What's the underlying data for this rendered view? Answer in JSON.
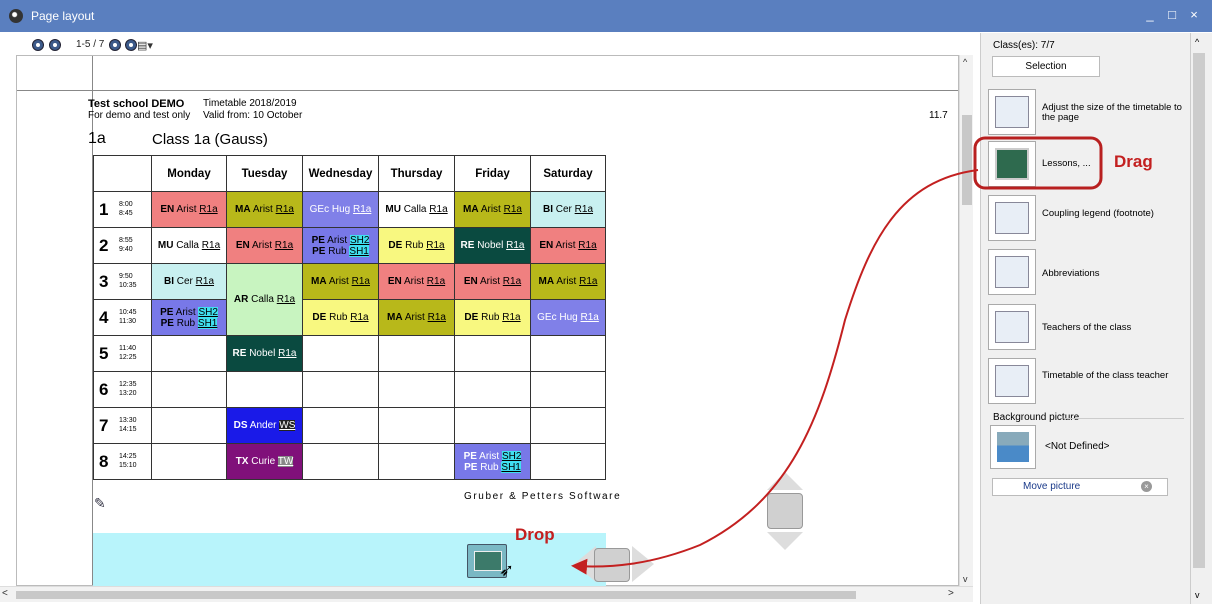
{
  "window": {
    "title": "Page layout",
    "min": "_",
    "max": "□",
    "close": "×"
  },
  "toolbar": {
    "page_indicator": "1-5 / 7",
    "layout_icon": "▤▾"
  },
  "header": {
    "school": "Test school DEMO",
    "timetable": "Timetable 2018/2019",
    "demo": "For demo and test only",
    "valid": "Valid from: 10 October",
    "page": "11.7"
  },
  "class": {
    "code": "1a",
    "name": "Class 1a (Gauss)"
  },
  "days": [
    "Monday",
    "Tuesday",
    "Wednesday",
    "Thursday",
    "Friday",
    "Saturday"
  ],
  "periods": [
    {
      "n": "1",
      "start": "8:00",
      "end": "8:45"
    },
    {
      "n": "2",
      "start": "8:55",
      "end": "9:40"
    },
    {
      "n": "3",
      "start": "9:50",
      "end": "10:35"
    },
    {
      "n": "4",
      "start": "10:45",
      "end": "11:30"
    },
    {
      "n": "5",
      "start": "11:40",
      "end": "12:25"
    },
    {
      "n": "6",
      "start": "12:35",
      "end": "13:20"
    },
    {
      "n": "7",
      "start": "13:30",
      "end": "14:15"
    },
    {
      "n": "8",
      "start": "14:25",
      "end": "15:10"
    }
  ],
  "lessons": {
    "EN": "EN",
    "MA": "MA",
    "GEc": "GEc",
    "MU": "MU",
    "BI": "BI",
    "PE": "PE",
    "DE": "DE",
    "RE": "RE",
    "AR": "AR",
    "DS": "DS",
    "TX": "TX",
    "Arist": "Arist",
    "Hug": "Hug",
    "Calla": "Calla",
    "Cer": "Cer",
    "Rub": "Rub",
    "Nobel": "Nobel",
    "Ander": "Ander",
    "Curie": "Curie",
    "R1a": "R1a",
    "SH1": "SH1",
    "SH2": "SH2",
    "WS": "WS",
    "TW": "TW"
  },
  "colors": {
    "en": "#f08080",
    "ma": "#b8b81a",
    "gec": "#8080e8",
    "mu": "#ffffff",
    "bi": "#c8f0f0",
    "pe": "#7878e8",
    "de": "#f8f880",
    "re": "#0a4a40",
    "ar": "#c8f4c0",
    "ds": "#1a1ae8",
    "tx": "#80107a"
  },
  "footer": {
    "company": "Gruber & Petters Software"
  },
  "panel": {
    "classes": "Class(es): 7/7",
    "selection": "Selection",
    "items": [
      "Adjust the size of the timetable to the page",
      "Lessons, ...",
      "Coupling legend (footnote)",
      "Abbreviations",
      "Teachers of the class",
      "Timetable of the class teacher"
    ],
    "background_label": "Background picture",
    "background_value": "<Not Defined>",
    "move_picture": "Move picture",
    "move_x": "×"
  },
  "annotations": {
    "drag": "Drag",
    "drop": "Drop"
  }
}
